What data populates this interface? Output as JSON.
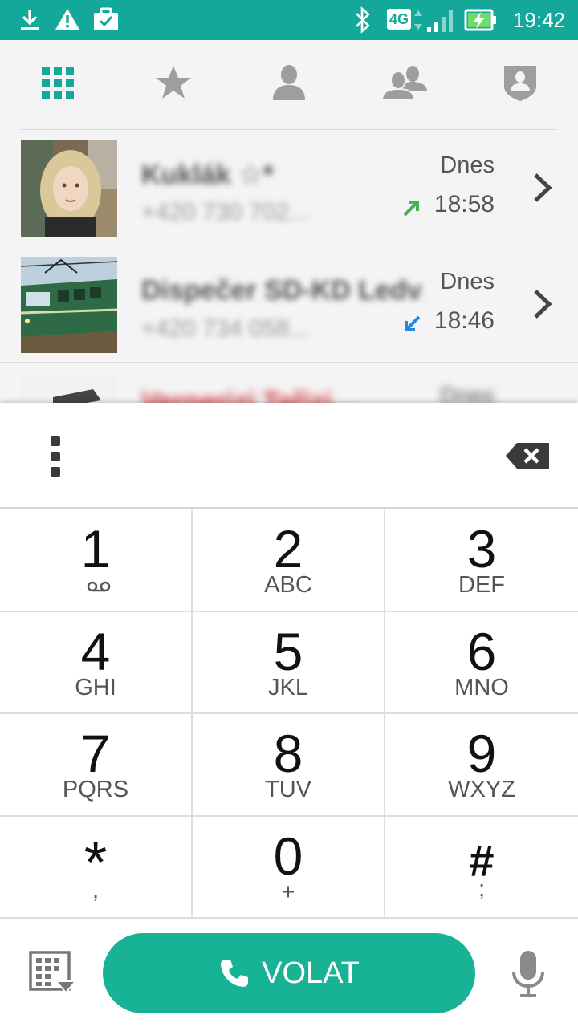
{
  "status_bar": {
    "time": "19:42",
    "network": "4G",
    "icons": [
      "download-icon",
      "warning-icon",
      "briefcase-icon",
      "bluetooth-icon",
      "signal-icon",
      "battery-charging-icon"
    ]
  },
  "tabs": [
    {
      "name": "dialpad",
      "icon": "grid-icon",
      "active": true
    },
    {
      "name": "favorites",
      "icon": "star-icon",
      "active": false
    },
    {
      "name": "contacts",
      "icon": "person-icon",
      "active": false
    },
    {
      "name": "groups",
      "icon": "group-icon",
      "active": false
    },
    {
      "name": "blocked",
      "icon": "shield-person-icon",
      "active": false
    }
  ],
  "call_log": [
    {
      "name": "Kuklák ☆*",
      "number": "+420 730 702...",
      "day": "Dnes",
      "time": "18:58",
      "direction": "outgoing",
      "direction_color": "#4caf50"
    },
    {
      "name": "Dispečer SD-KD Ledv..",
      "number": "+420 734 058...",
      "day": "Dnes",
      "time": "18:46",
      "direction": "incoming",
      "direction_color": "#1e88e5"
    },
    {
      "name": "Vernerizi Tařizi…",
      "number": "",
      "day": "Dnes",
      "time": "",
      "direction": "missed",
      "direction_color": "#d4373a"
    }
  ],
  "dialer": {
    "digits": "",
    "keys": [
      {
        "num": "1",
        "sub": ""
      },
      {
        "num": "2",
        "sub": "ABC"
      },
      {
        "num": "3",
        "sub": "DEF"
      },
      {
        "num": "4",
        "sub": "GHI"
      },
      {
        "num": "5",
        "sub": "JKL"
      },
      {
        "num": "6",
        "sub": "MNO"
      },
      {
        "num": "7",
        "sub": "PQRS"
      },
      {
        "num": "8",
        "sub": "TUV"
      },
      {
        "num": "9",
        "sub": "WXYZ"
      },
      {
        "num": "*",
        "sub": ","
      },
      {
        "num": "0",
        "sub": "+"
      },
      {
        "num": "#",
        "sub": ";"
      }
    ],
    "call_label": "VOLAT"
  },
  "colors": {
    "accent": "#14a89a",
    "call_button": "#17b394",
    "icon_gray": "#9e9e9e"
  }
}
